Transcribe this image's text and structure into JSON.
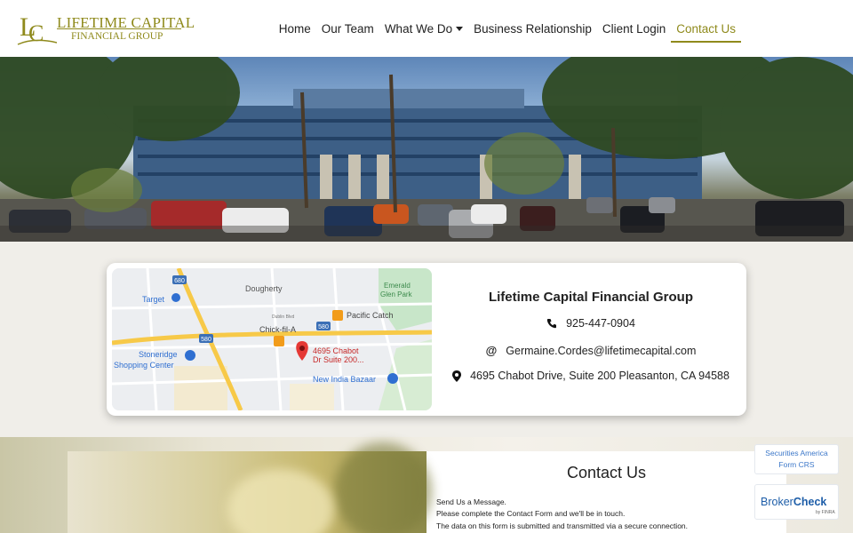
{
  "brand": {
    "logo_line1": "LIFETIME CAPITAL",
    "logo_line2": "FINANCIAL GROUP",
    "accent_color": "#8f8a1c"
  },
  "nav": {
    "items": [
      {
        "label": "Home"
      },
      {
        "label": "Our Team"
      },
      {
        "label": "What We Do"
      },
      {
        "label": "Business Relationship"
      },
      {
        "label": "Client Login"
      },
      {
        "label": "Contact Us"
      }
    ],
    "active": "Contact Us"
  },
  "map": {
    "labels": {
      "dougherty": "Dougherty",
      "emerald": "Emerald",
      "glen_park": "Glen Park",
      "target": "Target",
      "dublin_blvd": "Dublin Blvd",
      "pacific_catch": "Pacific Catch",
      "chick": "Chick-fil-A",
      "pin_line1": "4695 Chabot",
      "pin_line2": "Dr Suite 200...",
      "stoneridge1": "Stoneridge",
      "stoneridge2": "Shopping Center",
      "new_india": "New India Bazaar",
      "hwy_680": "680",
      "hwy_580": "580"
    }
  },
  "contact_card": {
    "title": "Lifetime Capital Financial Group",
    "phone": "925-447-0904",
    "email": "Germaine.Cordes@lifetimecapital.com",
    "address": "4695 Chabot Drive, Suite 200 Pleasanton, CA 94588"
  },
  "contact_form": {
    "title": "Contact Us",
    "line1": "Send Us a Message.",
    "line2": "Please complete the Contact Form and we'll be in touch.",
    "line3": "The data on this form is submitted and transmitted via a secure connection."
  },
  "widgets": {
    "securities_line1": "Securities America",
    "securities_line2": "Form CRS",
    "broker_part1": "Broker",
    "broker_part2": "Check",
    "broker_sub": "by FINRA"
  }
}
